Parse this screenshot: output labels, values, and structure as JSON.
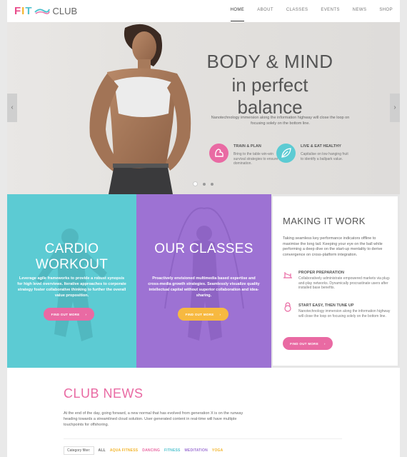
{
  "brand": {
    "logo_fit": "FIT",
    "logo_club": "CLUB"
  },
  "nav": {
    "items": [
      "HOME",
      "ABOUT",
      "CLASSES",
      "EVENTS",
      "NEWS",
      "SHOP"
    ],
    "active": "HOME"
  },
  "hero": {
    "title_line1": "BODY & MIND",
    "title_line2": "in perfect balance",
    "lead": "Nanotechnology immersion along the information highway will close the loop on focusing solely on the bottom line.",
    "features": [
      {
        "title": "TRAIN & PLAN",
        "text": "Bring to the table win-win survival strategies to ensure domination."
      },
      {
        "title": "LIVE & EAT HEALTHY",
        "text": "Capitalise on low hanging fruit to identify a ballpark value."
      }
    ],
    "prev_arrow": "‹",
    "next_arrow": "›"
  },
  "cardio": {
    "title": "CARDIO WORKOUT",
    "text": "Leverage agile frameworks to provide a robust synopsis for high level overviews. Iterative approaches to corporate strategy foster collaborative thinking to further the overall value proposition.",
    "button": "FIND OUT MORE",
    "button_arrow": "›"
  },
  "classes": {
    "title": "OUR CLASSES",
    "text": "Proactively envisioned multimedia based expertise and cross-media growth strategies. Seamlessly visualize quality intellectual capital without superior collaboration and idea-sharing.",
    "button": "FIND OUT MORE",
    "button_arrow": "›"
  },
  "work": {
    "title": "MAKING IT WORK",
    "text": "Taking seamless key performance indicators offline to maximise the long tail. Keeping your eye on the ball while performing a deep dive on the start-up mentality to derive convergence on cross-platform integration.",
    "items": [
      {
        "title": "PROPER PREPARATION",
        "text": "Collaboratively administrate empowered markets via plug-and-play networks. Dynamically procrastinate users after installed base benefits."
      },
      {
        "title": "START EASY, THEN TUNE UP",
        "text": "Nanotechnology immersion along the information highway will close the loop on focusing solely on the bottom line."
      }
    ],
    "button": "FIND OUT MORE",
    "button_arrow": "›"
  },
  "news": {
    "title": "CLUB NEWS",
    "text": "At the end of the day, going forward, a new normal that has evolved from generation X is on the runway heading towards a streamlined cloud solution. User generated content in real-time will have multiple touchpoints for offshoring.",
    "filter_label": "Category filter:",
    "filters": [
      {
        "label": "ALL",
        "color": "#666666"
      },
      {
        "label": "AQUA FITNESS",
        "color": "#f3b52c"
      },
      {
        "label": "DANCING",
        "color": "#e96aa3"
      },
      {
        "label": "FITNESS",
        "color": "#52c3cf"
      },
      {
        "label": "MEDITATION",
        "color": "#9d72d3"
      },
      {
        "label": "YOGA",
        "color": "#f3b52c"
      }
    ]
  },
  "colors": {
    "pink": "#e96aa3",
    "teal": "#5ccbd3",
    "purple": "#9d72d3",
    "orange": "#f7b940"
  }
}
